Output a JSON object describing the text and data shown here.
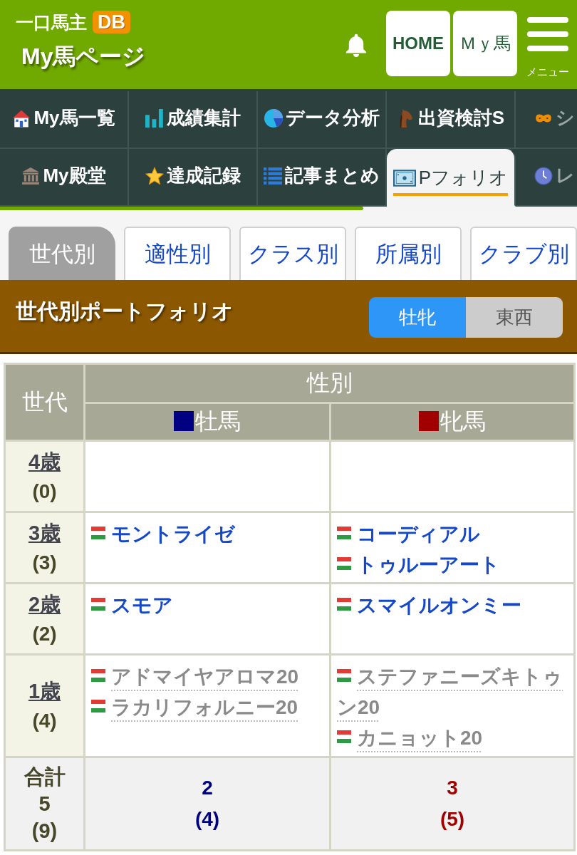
{
  "header": {
    "logo": {
      "text": "一口馬主",
      "badge": "DB"
    },
    "page_title": "My馬ページ",
    "buttons": [
      "HOME",
      "Ｍｙ馬"
    ],
    "menu_label": "メニュー"
  },
  "nav": {
    "items": [
      {
        "label": "My馬一覧",
        "selected": false
      },
      {
        "label": "成績集計",
        "selected": false
      },
      {
        "label": "データ分析",
        "selected": false
      },
      {
        "label": "出資検討S",
        "selected": false
      },
      {
        "label": "シ",
        "selected": false
      },
      {
        "label": "My殿堂",
        "selected": false
      },
      {
        "label": "達成記録",
        "selected": false
      },
      {
        "label": "記事まとめ",
        "selected": false
      },
      {
        "label": "Pフォリオ",
        "selected": true
      },
      {
        "label": "レ",
        "selected": false
      }
    ]
  },
  "tabs": [
    {
      "label": "世代別",
      "selected": true
    },
    {
      "label": "適性別",
      "selected": false
    },
    {
      "label": "クラス別",
      "selected": false
    },
    {
      "label": "所属別",
      "selected": false
    },
    {
      "label": "クラブ別",
      "selected": false
    }
  ],
  "section": {
    "title": "世代別ポートフォリオ",
    "toggle": [
      {
        "label": "牡牝",
        "selected": true
      },
      {
        "label": "東西",
        "selected": false
      }
    ]
  },
  "table": {
    "corner": "世代",
    "group_header": "性別",
    "columns": [
      {
        "label": "牡馬",
        "color": "#000080"
      },
      {
        "label": "牝馬",
        "color": "#a00000"
      }
    ],
    "rows": [
      {
        "age": "4歳",
        "count": "(0)",
        "cells": [
          {},
          {}
        ]
      },
      {
        "age": "3歳",
        "count": "(3)",
        "cells": [
          {
            "horses": [
              {
                "name": "モントライゼ",
                "kind": "named"
              }
            ]
          },
          {
            "horses": [
              {
                "name": "コーディアル",
                "kind": "named"
              },
              {
                "name": "トゥルーアート",
                "kind": "named"
              }
            ]
          }
        ]
      },
      {
        "age": "2歳",
        "count": "(2)",
        "cells": [
          {
            "horses": [
              {
                "name": "スモア",
                "kind": "named"
              }
            ]
          },
          {
            "horses": [
              {
                "name": "スマイルオンミー",
                "kind": "named"
              }
            ]
          }
        ]
      },
      {
        "age": "1歳",
        "count": "(4)",
        "cells": [
          {
            "horses": [
              {
                "name": "アドマイヤアロマ20",
                "kind": "unnamed"
              },
              {
                "name": "ラカリフォルニー20",
                "kind": "unnamed"
              }
            ]
          },
          {
            "horses": [
              {
                "name": "ステファニーズキトゥン20",
                "kind": "unnamed"
              },
              {
                "name": "カニョット20",
                "kind": "unnamed"
              }
            ]
          }
        ]
      }
    ],
    "total": {
      "label": "合計",
      "count": "5",
      "sub": "(9)",
      "cells": [
        {
          "count": "2",
          "sub": "(4)"
        },
        {
          "count": "3",
          "sub": "(5)"
        }
      ]
    }
  }
}
